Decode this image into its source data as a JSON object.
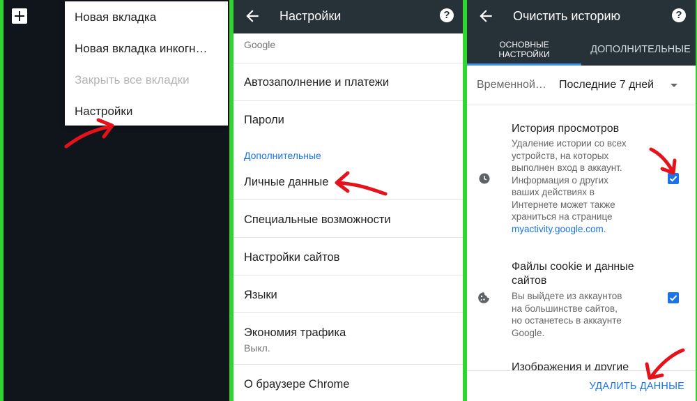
{
  "panel1": {
    "menu_items": [
      {
        "label": "Новая вкладка"
      },
      {
        "label": "Новая вкладка инкогн…"
      },
      {
        "label": "Закрыть все вкладки"
      },
      {
        "label": "Настройки"
      }
    ]
  },
  "panel2": {
    "title": "Настройки",
    "help": "?",
    "top_label": "Google",
    "items": [
      {
        "label": "Автозаполнение и платежи"
      },
      {
        "label": "Пароли"
      },
      {
        "label": "Личные данные"
      },
      {
        "label": "Специальные возможности"
      },
      {
        "label": "Настройки сайтов"
      },
      {
        "label": "Языки"
      },
      {
        "label": "Экономия трафика",
        "sub": "Выкл."
      },
      {
        "label": "О браузере Chrome"
      }
    ],
    "section_header": "Дополнительные"
  },
  "panel3": {
    "title": "Очистить историю",
    "help": "?",
    "tabs": {
      "basic_line1": "ОСНОВНЫЕ",
      "basic_line2": "НАСТРОЙКИ",
      "advanced": "ДОПОЛНИТЕЛЬНЫЕ"
    },
    "time_range": {
      "label": "Временной…",
      "value": "Последние 7 дней"
    },
    "history": {
      "title": "История просмотров",
      "desc_lines": [
        "Удаление истории со всех",
        "устройств, на которых",
        "выполнен вход в аккаунт.",
        "Информация о других",
        "ваших действиях в",
        "Интернете может также",
        "храниться на странице"
      ],
      "link": "myactivity.google.com",
      "link_tail": ".",
      "checked": true
    },
    "cookies": {
      "title_line1": "Файлы cookie и данные",
      "title_line2": "сайтов",
      "desc_lines": [
        "Вы выйдете из аккаунтов",
        "на большинстве сайтов,",
        "но останетесь в аккаунте",
        "Google."
      ],
      "checked": true
    },
    "images_partial": "Изображения и другие",
    "clear_button": "УДАЛИТЬ ДАННЫЕ"
  },
  "colors": {
    "appbar": "#263238",
    "accent": "#1a73e8",
    "arrow": "#e5121b",
    "border": "#2fd62f"
  }
}
